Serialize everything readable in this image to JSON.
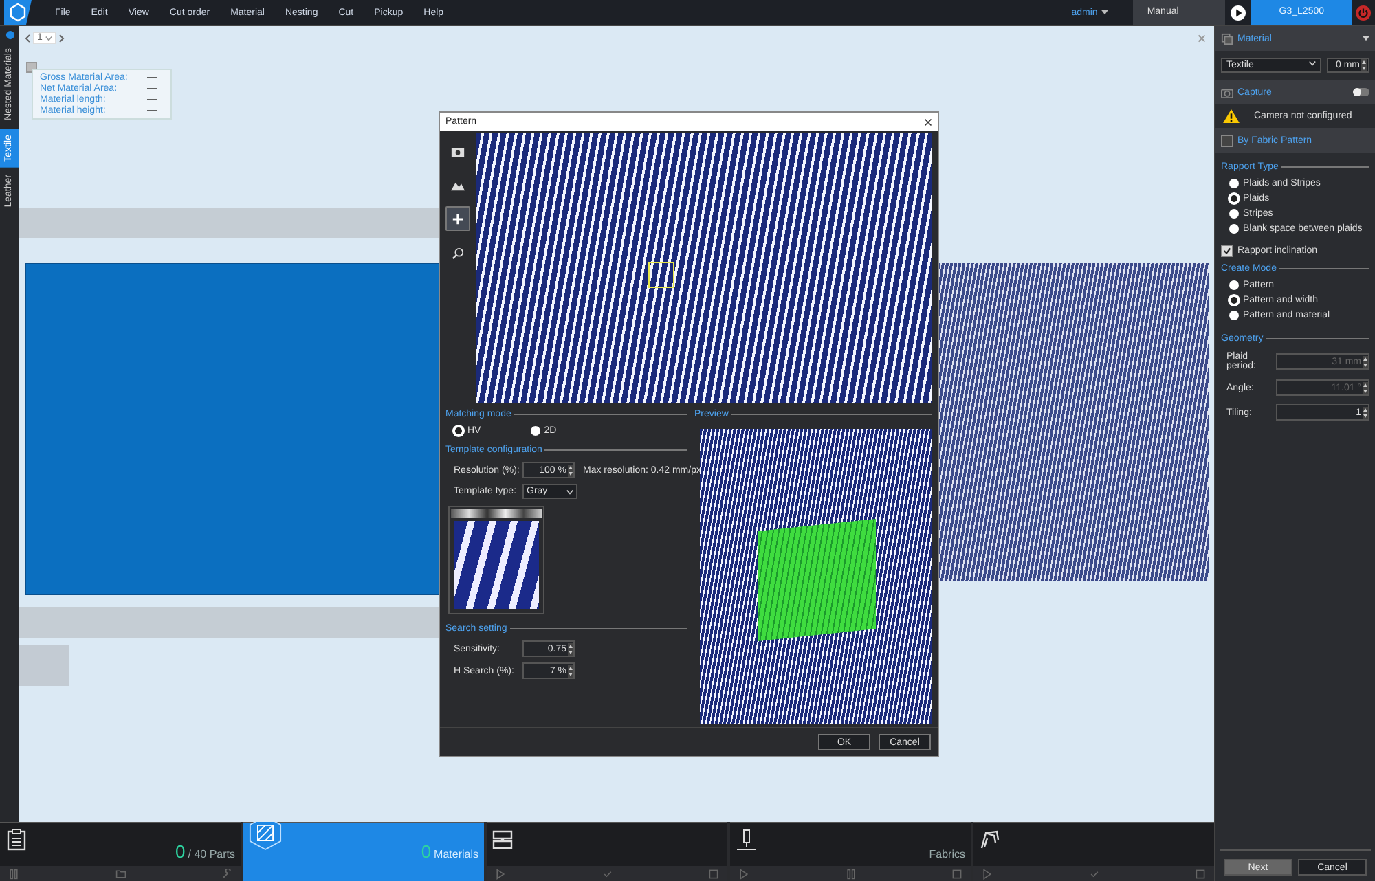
{
  "menu_bar": {
    "items": [
      "File",
      "Edit",
      "View",
      "Cut order",
      "Material",
      "Nesting",
      "Cut",
      "Pickup",
      "Help"
    ],
    "user": "admin",
    "mode": "Manual",
    "machine": "G3_L2500"
  },
  "side_tabs": [
    {
      "label": "Nested Materials",
      "selected": false
    },
    {
      "label": "Textile",
      "selected": true
    },
    {
      "label": "Leather",
      "selected": false
    }
  ],
  "canvas": {
    "page": "1",
    "checked": false,
    "info": [
      {
        "label": "Gross Material Area:",
        "value": "—"
      },
      {
        "label": "Net Material Area:",
        "value": "—"
      },
      {
        "label": "Material length:",
        "value": "—"
      },
      {
        "label": "Material height:",
        "value": "—"
      }
    ]
  },
  "pattern_dialog": {
    "title": "Pattern",
    "tools": [
      {
        "kind": "camera",
        "selected": false
      },
      {
        "kind": "mountain",
        "selected": false
      },
      {
        "kind": "plus",
        "selected": true
      },
      {
        "kind": "search",
        "selected": false
      }
    ],
    "matching_mode": {
      "heading": "Matching mode",
      "options": [
        {
          "label": "HV",
          "selected": true
        },
        {
          "label": "2D",
          "selected": false
        }
      ]
    },
    "template": {
      "heading": "Template configuration",
      "resolution_label": "Resolution (%):",
      "resolution": "100 %",
      "max_resolution": "Max resolution: 0.42 mm/px",
      "type_label": "Template type:",
      "type": "Gray"
    },
    "search": {
      "heading": "Search setting",
      "fields": [
        {
          "label": "Sensitivity:",
          "value": "0.75"
        },
        {
          "label": "H Search (%):",
          "value": "7 %"
        }
      ]
    },
    "preview_heading": "Preview",
    "buttons": [
      "OK",
      "Cancel"
    ]
  },
  "right_panel": {
    "material": {
      "title": "Material",
      "type": "Textile",
      "offset": "0 mm"
    },
    "capture": {
      "title": "Capture",
      "on": false,
      "warning": "Camera not configured"
    },
    "fabric_pattern": {
      "title": "By Fabric Pattern",
      "checked": false
    },
    "rapport_type": {
      "heading": "Rapport Type",
      "options": [
        {
          "label": "Plaids and Stripes",
          "selected": false
        },
        {
          "label": "Plaids",
          "selected": true
        },
        {
          "label": "Stripes",
          "selected": false
        },
        {
          "label": "Blank space between plaids",
          "selected": false
        }
      ]
    },
    "rapport_inclination": {
      "label": "Rapport inclination",
      "checked": true
    },
    "create_mode": {
      "heading": "Create Mode",
      "options": [
        {
          "label": "Pattern",
          "selected": false
        },
        {
          "label": "Pattern and width",
          "selected": true
        },
        {
          "label": "Pattern and material",
          "selected": false
        }
      ]
    },
    "geometry": {
      "heading": "Geometry",
      "fields": [
        {
          "label": "Plaid period:",
          "value": "31 mm",
          "disabled": true
        },
        {
          "label": "Angle:",
          "value": "11.01 °",
          "disabled": true
        },
        {
          "label": "Tiling:",
          "value": "1",
          "disabled": false
        }
      ]
    },
    "buttons": [
      "Next",
      "Cancel"
    ]
  },
  "bottom_cards": [
    {
      "kind": "parts",
      "count": "0",
      "label": "/ 40 Parts",
      "selected": false
    },
    {
      "kind": "materials",
      "count": "0",
      "label": "Materials",
      "selected": true
    },
    {
      "kind": "nesting",
      "selected": false
    },
    {
      "kind": "cut",
      "label": "Fabrics",
      "selected": false
    },
    {
      "kind": "pickup",
      "selected": false
    }
  ]
}
